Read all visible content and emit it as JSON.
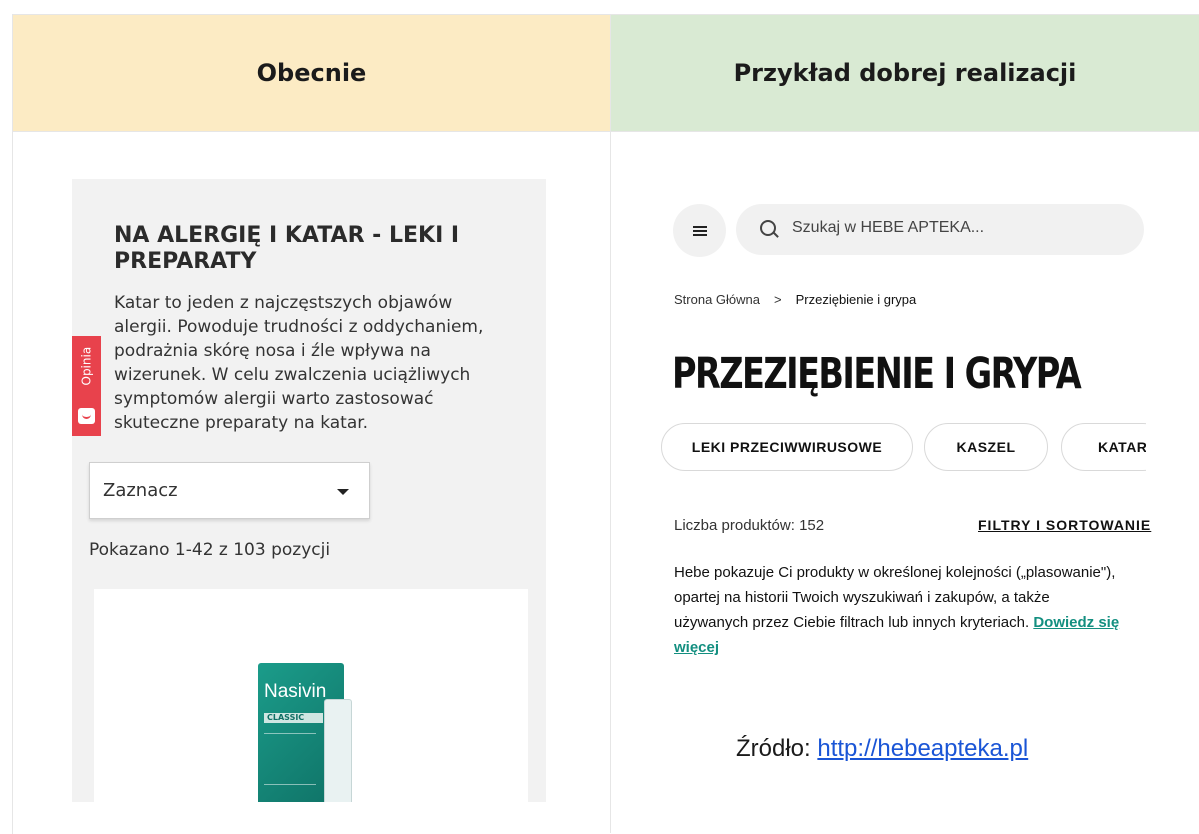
{
  "headers": {
    "left": "Obecnie",
    "right": "Przykład dobrej realizacji"
  },
  "left": {
    "title": "NA ALERGIĘ I KATAR - LEKI I PREPARATY",
    "description": "Katar to jeden z najczęstszych objawów alergii. Powoduje trudności z oddychaniem, podrażnia skórę nosa i źle wpływa na wizerunek. W celu zwalczenia uciążliwych symptomów alergii warto zastosować skuteczne preparaty na katar.",
    "feedback_tab": "Opinia",
    "select_value": "Zaznacz",
    "count_text": "Pokazano 1-42 z 103 pozycji",
    "product": {
      "brand": "Nasivin",
      "variant": "CLASSIC"
    }
  },
  "right": {
    "search_placeholder": "Szukaj w HEBE APTEKA...",
    "breadcrumb": {
      "home": "Strona Główna",
      "sep": ">",
      "current": "Przeziębienie i grypa"
    },
    "title": "PRZEZIĘBIENIE I GRYPA",
    "chips": [
      "LEKI PRZECIWWIRUSOWE",
      "KASZEL",
      "KATAR"
    ],
    "product_count": "Liczba produktów: 152",
    "filters_label": "FILTRY I SORTOWANIE",
    "description": "Hebe pokazuje Ci produkty w określonej kolejności („plasowanie\"), opartej na historii Twoich wyszukiwań i zakupów, a także używanych przez Ciebie filtrach lub innych kryteriach.",
    "learn_more": "Dowiedz się więcej"
  },
  "source": {
    "label": "Źródło:",
    "link": "http://hebeapteka.pl"
  }
}
